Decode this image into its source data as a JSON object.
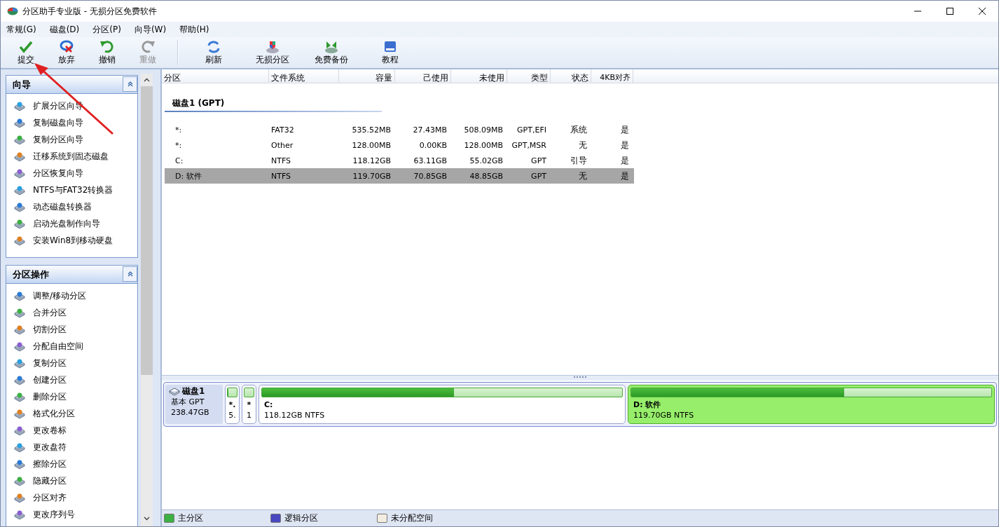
{
  "window": {
    "title": "分区助手专业版 - 无损分区免费软件"
  },
  "menu": [
    "常规(G)",
    "磁盘(D)",
    "分区(P)",
    "向导(W)",
    "帮助(H)"
  ],
  "toolbar": {
    "groups": [
      [
        {
          "label": "提交",
          "kind": "check",
          "disabled": false
        },
        {
          "label": "放弃",
          "kind": "discard",
          "disabled": false
        },
        {
          "label": "撤销",
          "kind": "undo",
          "disabled": false
        },
        {
          "label": "重做",
          "kind": "redo",
          "disabled": true
        }
      ],
      [
        {
          "label": "刷新",
          "kind": "refresh",
          "disabled": false
        },
        {
          "label": "无损分区",
          "kind": "shield",
          "disabled": false
        },
        {
          "label": "免费备份",
          "kind": "backup",
          "disabled": false
        },
        {
          "label": "教程",
          "kind": "book",
          "disabled": false
        }
      ]
    ]
  },
  "sidebar": {
    "sections": [
      {
        "title": "向导",
        "expanded": true,
        "items": [
          "扩展分区向导",
          "复制磁盘向导",
          "复制分区向导",
          "迁移系统到固态磁盘",
          "分区恢复向导",
          "NTFS与FAT32转换器",
          "动态磁盘转换器",
          "启动光盘制作向导",
          "安装Win8到移动硬盘"
        ]
      },
      {
        "title": "分区操作",
        "expanded": true,
        "items": [
          "调整/移动分区",
          "合并分区",
          "切割分区",
          "分配自由空间",
          "复制分区",
          "创建分区",
          "删除分区",
          "格式化分区",
          "更改卷标",
          "更改盘符",
          "擦除分区",
          "隐藏分区",
          "分区对齐",
          "更改序列号"
        ]
      }
    ]
  },
  "table": {
    "columns": [
      "分区",
      "文件系统",
      "容量",
      "己使用",
      "未使用",
      "类型",
      "状态",
      "4KB对齐"
    ],
    "groups": [
      {
        "title": "磁盘1 (GPT)",
        "rows": [
          {
            "cells": [
              "*:",
              "FAT32",
              "535.52MB",
              "27.43MB",
              "508.09MB",
              "GPT,EFI",
              "系统",
              "是"
            ],
            "selected": false
          },
          {
            "cells": [
              "*:",
              "Other",
              "128.00MB",
              "0.00KB",
              "128.00MB",
              "GPT,MSR",
              "无",
              "是"
            ],
            "selected": false
          },
          {
            "cells": [
              "C:",
              "NTFS",
              "118.12GB",
              "63.11GB",
              "55.02GB",
              "GPT",
              "引导",
              "是"
            ],
            "selected": false
          },
          {
            "cells": [
              "D: 软件",
              "NTFS",
              "119.70GB",
              "70.85GB",
              "48.85GB",
              "GPT",
              "无",
              "是"
            ],
            "selected": true
          }
        ]
      }
    ]
  },
  "disk_map": {
    "disks": [
      {
        "name": "磁盘1",
        "type": "基本 GPT",
        "size": "238.47GB",
        "partitions": [
          {
            "label": "*.",
            "detail": "5.",
            "compact": true,
            "level": 0.05,
            "selected": false
          },
          {
            "label": "*",
            "detail": "1",
            "compact": true,
            "selected": false
          },
          {
            "label": "C:",
            "detail": "118.12GB NTFS",
            "compact": false,
            "level": 0.534,
            "selected": false
          },
          {
            "label": "D: 软件",
            "detail": "119.70GB NTFS",
            "compact": false,
            "level": 0.592,
            "selected": true
          }
        ]
      }
    ]
  },
  "legend": [
    {
      "label": "主分区",
      "color": "#3cb043"
    },
    {
      "label": "逻辑分区",
      "color": "#4848c0"
    },
    {
      "label": "未分配空间",
      "color": "#f3ece0"
    }
  ]
}
